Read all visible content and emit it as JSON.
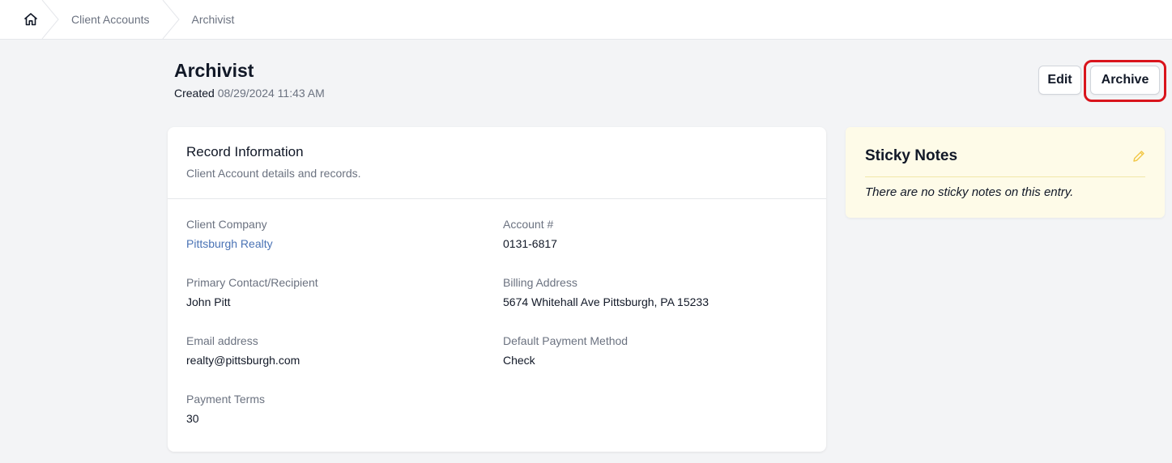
{
  "breadcrumb": {
    "home_icon": "home-icon",
    "items": [
      "Client Accounts",
      "Archivist"
    ]
  },
  "header": {
    "title": "Archivist",
    "created_label": "Created",
    "created_value": "08/29/2024 11:43 AM",
    "edit_label": "Edit",
    "archive_label": "Archive",
    "highlight_color": "#d9141c"
  },
  "record": {
    "title": "Record Information",
    "subtitle": "Client Account details and records.",
    "fields": [
      {
        "label": "Client Company",
        "value": "Pittsburgh Realty"
      },
      {
        "label": "Account #",
        "value": "0131-6817"
      },
      {
        "label": "Primary Contact/Recipient",
        "value": "John Pitt"
      },
      {
        "label": "Billing Address",
        "value": "5674 Whitehall Ave Pittsburgh, PA 15233"
      },
      {
        "label": "Email address",
        "value": "realty@pittsburgh.com"
      },
      {
        "label": "Default Payment Method",
        "value": "Check"
      },
      {
        "label": "Payment Terms",
        "value": "30"
      }
    ],
    "link_color": "#4a73b5"
  },
  "sticky": {
    "title": "Sticky Notes",
    "empty_text": "There are no sticky notes on this entry.",
    "edit_icon": "pencil-icon",
    "background": "#fefbe8"
  }
}
